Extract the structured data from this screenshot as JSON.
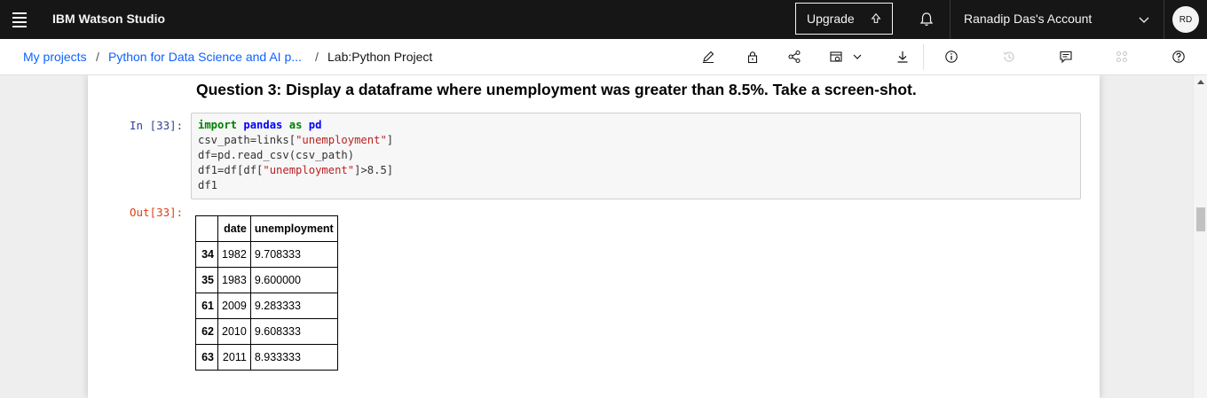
{
  "header": {
    "brand": "IBM Watson Studio",
    "upgrade_label": "Upgrade",
    "account_label": "Ranadip Das's Account",
    "avatar_initials": "RD"
  },
  "breadcrumb": {
    "items": [
      "My projects",
      "Python for Data Science and AI p...",
      "Lab:Python Project"
    ],
    "separator": "/"
  },
  "toolbar": {
    "icons": [
      "edit-icon",
      "lock-icon",
      "share-icon",
      "schedule-icon",
      "download-icon",
      "info-icon",
      "history-icon",
      "comments-icon",
      "integrations-icon",
      "help-icon"
    ]
  },
  "notebook": {
    "question": "Question 3: Display a dataframe where unemployment was greater than 8.5%. Take a screen-shot.",
    "in_prompt": "In [33]:",
    "out_prompt": "Out[33]:",
    "code_lines": [
      "import pandas as pd",
      "csv_path=links[\"unemployment\"]",
      "df=pd.read_csv(csv_path)",
      "df1=df[df[\"unemployment\"]>8.5]",
      "df1"
    ],
    "table": {
      "columns": [
        "",
        "date",
        "unemployment"
      ],
      "rows": [
        {
          "index": "34",
          "date": "1982",
          "unemployment": "9.708333"
        },
        {
          "index": "35",
          "date": "1983",
          "unemployment": "9.600000"
        },
        {
          "index": "61",
          "date": "2009",
          "unemployment": "9.283333"
        },
        {
          "index": "62",
          "date": "2010",
          "unemployment": "9.608333"
        },
        {
          "index": "63",
          "date": "2011",
          "unemployment": "8.933333"
        }
      ]
    }
  },
  "colors": {
    "header_bg": "#161616",
    "link": "#0f62fe",
    "in_prompt": "#303f9f",
    "out_prompt": "#d84315"
  }
}
